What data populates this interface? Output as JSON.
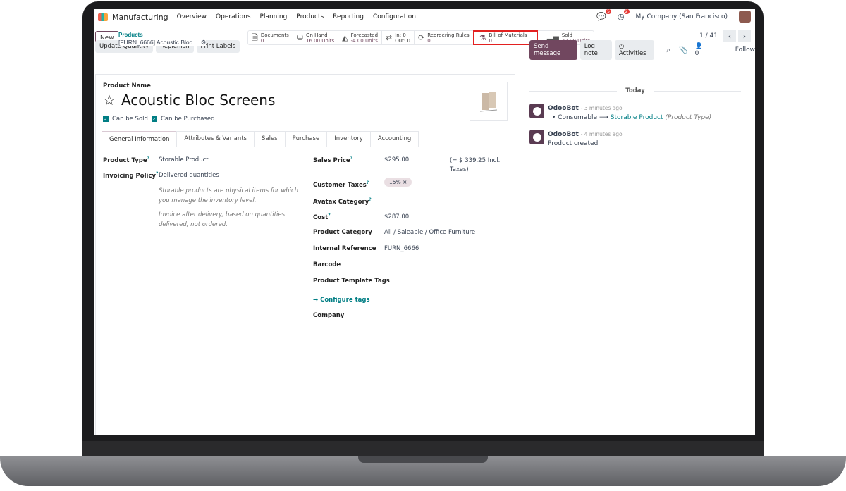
{
  "nav": {
    "app": "Manufacturing",
    "menu": [
      "Overview",
      "Operations",
      "Planning",
      "Products",
      "Reporting",
      "Configuration"
    ],
    "messages_count": "5",
    "activities_count": "2",
    "company": "My Company (San Francisco)"
  },
  "control": {
    "new_label": "New",
    "breadcrumb_parent": "Products",
    "breadcrumb_current": "[FURN_6666] Acoustic Bloc ...",
    "stats": [
      {
        "label": "Documents",
        "value": "0",
        "icon": "document-icon"
      },
      {
        "label": "On Hand",
        "value": "16.00 Units",
        "icon": "cubes-icon"
      },
      {
        "label": "Forecasted",
        "value": "-4.00 Units",
        "icon": "area-chart-icon"
      },
      {
        "label": "In: 0",
        "value": "Out: 0",
        "icon": "exchange-icon"
      },
      {
        "label": "Reordering Rules",
        "value": "0",
        "icon": "refresh-icon"
      },
      {
        "label": "Bill of Materials",
        "value": "0",
        "icon": "flask-icon"
      },
      {
        "label": "Sold",
        "value": "47.00 Units",
        "icon": "signal-icon"
      }
    ],
    "pager": "1 / 41"
  },
  "actions": [
    "Update Quantity",
    "Replenish",
    "Print Labels"
  ],
  "chatter_buttons": {
    "send": "Send message",
    "log": "Log note",
    "activities": "Activities",
    "followers": "0",
    "follow": "Follow"
  },
  "form": {
    "name_label": "Product Name",
    "name": "Acoustic Bloc Screens",
    "can_be_sold": "Can be Sold",
    "can_be_purchased": "Can be Purchased",
    "tabs": [
      "General Information",
      "Attributes & Variants",
      "Sales",
      "Purchase",
      "Inventory",
      "Accounting"
    ],
    "product_type_label": "Product Type",
    "product_type": "Storable Product",
    "invoicing_label": "Invoicing Policy",
    "invoicing": "Delivered quantities",
    "help1": "Storable products are physical items for which you manage the inventory level.",
    "help2": "Invoice after delivery, based on quantities delivered, not ordered.",
    "sales_price_label": "Sales Price",
    "sales_price": "$295.00",
    "incl_taxes": "(= $ 339.25 Incl. Taxes)",
    "taxes_label": "Customer Taxes",
    "tax_tag": "15%",
    "avatax_label": "Avatax Category",
    "cost_label": "Cost",
    "cost": "$287.00",
    "category_label": "Product Category",
    "category": "All / Saleable / Office Furniture",
    "ref_label": "Internal Reference",
    "ref": "FURN_6666",
    "barcode_label": "Barcode",
    "tags_label": "Product Template Tags",
    "configure_tags": "Configure tags",
    "company_label": "Company"
  },
  "chatter": {
    "today": "Today",
    "messages": [
      {
        "author": "OdooBot",
        "time": "- 3 minutes ago",
        "old": "Consumable",
        "new": "Storable Product",
        "field": "(Product Type)"
      },
      {
        "author": "OdooBot",
        "time": "- 4 minutes ago",
        "body": "Product created"
      }
    ]
  },
  "colors": {
    "primary": "#71475f",
    "link": "#017e84",
    "highlight": "#e32020"
  }
}
